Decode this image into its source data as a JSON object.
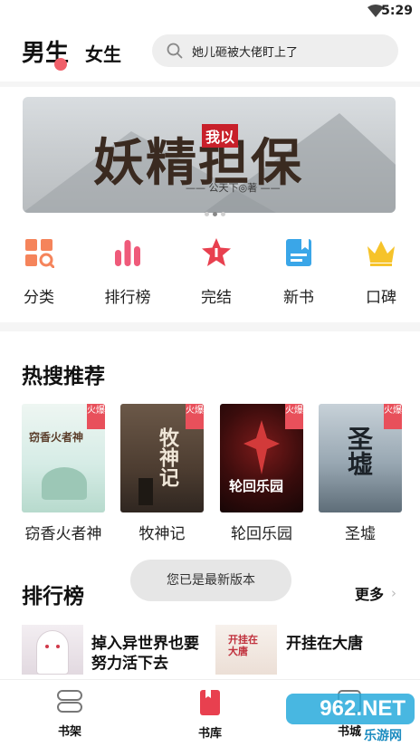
{
  "status_bar": {
    "time": "5:29"
  },
  "header": {
    "tab_male": "男生",
    "tab_female": "女生",
    "search_placeholder": "她儿砸被大佬盯上了"
  },
  "banner": {
    "title": "妖精担保",
    "seal": "我以",
    "author": "—— 公天下◎著 ——",
    "active_index": 1,
    "dot_count": 3
  },
  "categories": [
    {
      "label": "分类",
      "icon": "category-grid-icon",
      "color": "#f5845b"
    },
    {
      "label": "排行榜",
      "icon": "ranking-bars-icon",
      "color": "#ef5a7a"
    },
    {
      "label": "完结",
      "icon": "star-badge-icon",
      "color": "#e8404f"
    },
    {
      "label": "新书",
      "icon": "new-book-icon",
      "color": "#3aa6e8"
    },
    {
      "label": "口碑",
      "icon": "crown-icon",
      "color": "#f6c32a"
    }
  ],
  "hot_search": {
    "title": "热搜推荐",
    "books": [
      {
        "title": "窃香火者神",
        "tag": "火爆",
        "cover_text": "窃香火者神"
      },
      {
        "title": "牧神记",
        "tag": "火爆",
        "cover_text": "牧神记"
      },
      {
        "title": "轮回乐园",
        "tag": "火爆",
        "cover_text": "轮回乐园"
      },
      {
        "title": "圣墟",
        "tag": "火爆",
        "cover_text": "圣墟"
      }
    ]
  },
  "toast": "您已是最新版本",
  "ranking": {
    "title": "排行榜",
    "more_label": "更多",
    "items": [
      {
        "title": "掉入异世界也要努力活下去"
      },
      {
        "title": "开挂在大唐",
        "cover_text": "开挂在大唐"
      }
    ]
  },
  "bottom_nav": {
    "items": [
      {
        "label": "书架",
        "icon": "bookshelf-icon"
      },
      {
        "label": "书库",
        "icon": "library-icon",
        "active": true
      },
      {
        "label": "书城",
        "icon": "bookstore-icon"
      }
    ]
  },
  "watermark": {
    "text": "962.NET",
    "sub": "乐游网"
  },
  "colors": {
    "accent": "#e8404f",
    "background": "#ffffff",
    "divider": "#f5f5f5"
  }
}
